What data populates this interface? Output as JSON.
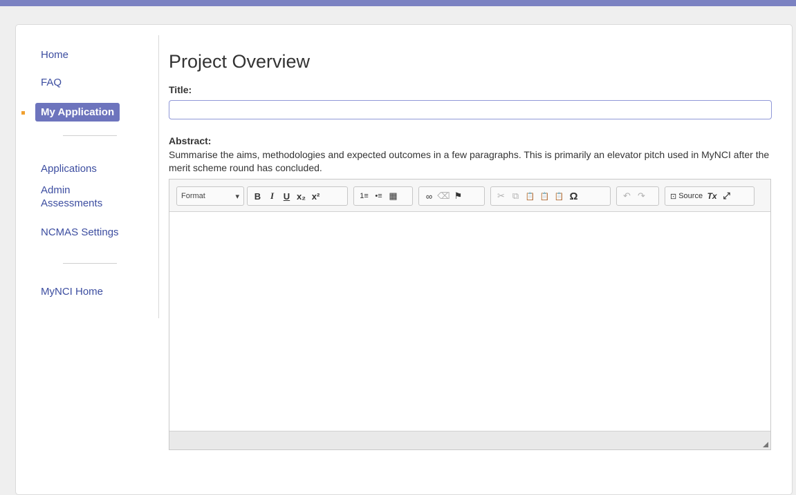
{
  "colors": {
    "accent": "#7b82c2",
    "active_nav": "#6d74bd",
    "link": "#3c4da0",
    "bullet": "#f0a030"
  },
  "sidebar": {
    "primary": [
      {
        "label": "Home"
      },
      {
        "label": "FAQ"
      },
      {
        "label": "My Application",
        "active": true
      }
    ],
    "secondary": [
      {
        "label": "Applications"
      },
      {
        "label": "Admin Assessments"
      },
      {
        "label": "NCMAS Settings"
      }
    ],
    "tertiary": [
      {
        "label": "MyNCI Home"
      }
    ]
  },
  "main": {
    "page_title": "Project Overview",
    "title_label": "Title:",
    "title_value": "",
    "abstract_label": "Abstract:",
    "abstract_help": "Summarise the aims, methodologies and expected outcomes in a few paragraphs. This is primarily an elevator pitch used in MyNCI after the merit scheme round has concluded."
  },
  "editor": {
    "format_label": "Format",
    "format_caret": "▾",
    "source_label": "Source",
    "buttons": {
      "bold": "B",
      "italic": "I",
      "underline": "U",
      "subscript": "x₂",
      "superscript": "x²",
      "numbered_list": "1≡",
      "bulleted_list": "•≡",
      "table": "▦",
      "link": "∞",
      "unlink": "⌫",
      "anchor": "⚑",
      "cut": "✂",
      "copy": "⧉",
      "paste": "📋",
      "paste_text": "📋",
      "paste_word": "📋",
      "special_char": "Ω",
      "undo": "↶",
      "redo": "↷",
      "source_icon": "⊡",
      "remove_format": "Tx",
      "maximize": "⤢"
    },
    "content": ""
  }
}
